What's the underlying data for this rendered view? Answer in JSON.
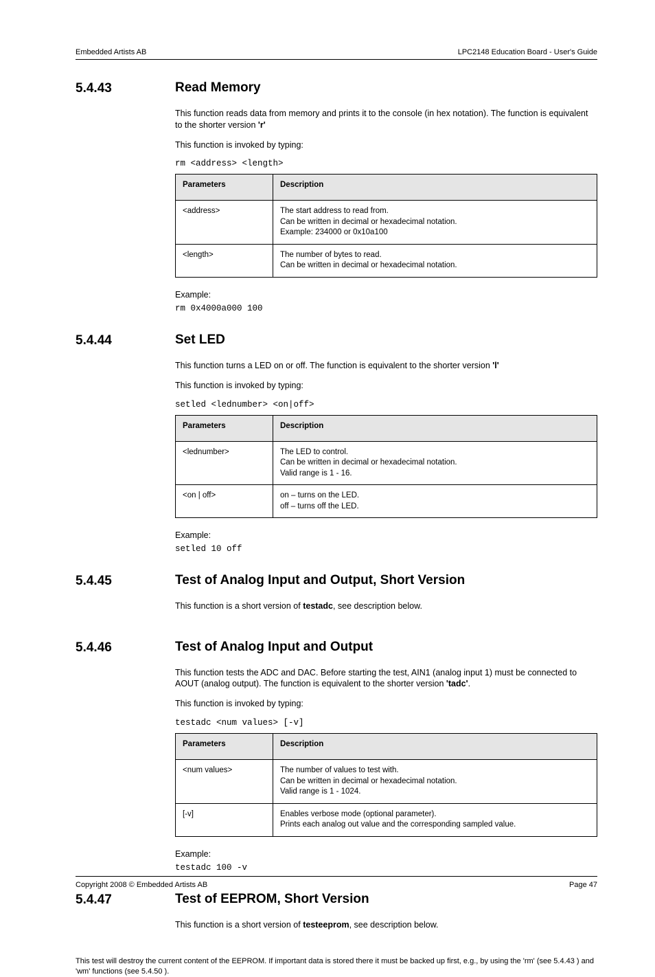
{
  "header": {
    "left": "Embedded Artists AB",
    "right": "LPC2148 Education Board - User's Guide"
  },
  "sections": [
    {
      "num": "5.4.43",
      "title": "Read Memory",
      "desc_pre": "This function reads data from memory and prints it to the console (in hex notation). The function is equivalent to the shorter version ",
      "desc_bold": "'r'",
      "desc_post": "",
      "invoke": "This function is invoked by typing:",
      "code": "rm <address> <length>",
      "params": {
        "headers": [
          "Parameters",
          "Description"
        ],
        "rows": [
          {
            "p": "<address>",
            "d1": "The start address to read from.",
            "d2": "Can be written in decimal or hexadecimal notation.",
            "d3": "Example: 234000 or 0x10a100"
          },
          {
            "p": "<length>",
            "d1": "The number of bytes to read.",
            "d2": "Can be written in decimal or hexadecimal notation.",
            "d3": ""
          }
        ]
      },
      "example_label": "Example:",
      "example_code": "rm 0x4000a000 100"
    },
    {
      "num": "5.4.44",
      "title": "Set LED",
      "desc_pre": "This function turns a LED on or off. The function is equivalent to the shorter version ",
      "desc_bold": "'l'",
      "desc_post": "",
      "invoke": "This function is invoked by typing:",
      "code": "setled <lednumber> <on|off>",
      "params": {
        "headers": [
          "Parameters",
          "Description"
        ],
        "rows": [
          {
            "p": "<lednumber>",
            "d1": "The LED to control.",
            "d2": "Can be written in decimal or hexadecimal notation.",
            "d3": "Valid range is 1 - 16."
          },
          {
            "p": "<on | off>",
            "d1": "on – turns on the LED.",
            "d2": "off – turns off the LED.",
            "d3": ""
          }
        ]
      },
      "example_label": "Example:",
      "example_code": "setled 10 off"
    },
    {
      "num": "5.4.45",
      "title": "Test of Analog Input and Output, Short Version",
      "desc_pre": "This function is a short version of ",
      "desc_bold": "testadc",
      "desc_post": ", see description below.",
      "invoke": null,
      "code": null,
      "params": null,
      "example_label": null,
      "example_code": null
    },
    {
      "num": "5.4.46",
      "title": "Test of Analog Input and Output",
      "desc_pre": "This function tests the ADC and DAC. Before starting the test, AIN1 (analog input 1) must be connected to AOUT (analog output). The function is equivalent to the shorter version ",
      "desc_bold": "'tadc'",
      "desc_post": ".",
      "invoke": "This function is invoked by typing:",
      "code": "testadc <num values> [-v]",
      "params": {
        "headers": [
          "Parameters",
          "Description"
        ],
        "rows": [
          {
            "p": "<num values>",
            "d1": "The number of values to test with.",
            "d2": "Can be written in decimal or hexadecimal notation.",
            "d3": "Valid range is 1 - 1024."
          },
          {
            "p": "[-v]",
            "d1": "Enables verbose mode (optional parameter).",
            "d2": "Prints each analog out value and the corresponding sampled value.",
            "d3": ""
          }
        ]
      },
      "example_label": "Example:",
      "example_code": "testadc 100 -v"
    },
    {
      "num": "5.4.47",
      "title": "Test of EEPROM, Short Version",
      "desc_pre": "This function is a short version of ",
      "desc_bold": "testeeprom",
      "desc_post": ", see description below.",
      "invoke": null,
      "code": null,
      "params": null,
      "example_label": null,
      "example_code": null
    }
  ],
  "notice": "This test will destroy the current content of the EEPROM. If important data is stored there it must be backed up first, e.g., by using the 'rm' (see 5.4.43 ) and 'wm' functions (see 5.4.50 ).",
  "footer": {
    "left": "Copyright 2008 © Embedded Artists AB",
    "right": "Page 47"
  }
}
